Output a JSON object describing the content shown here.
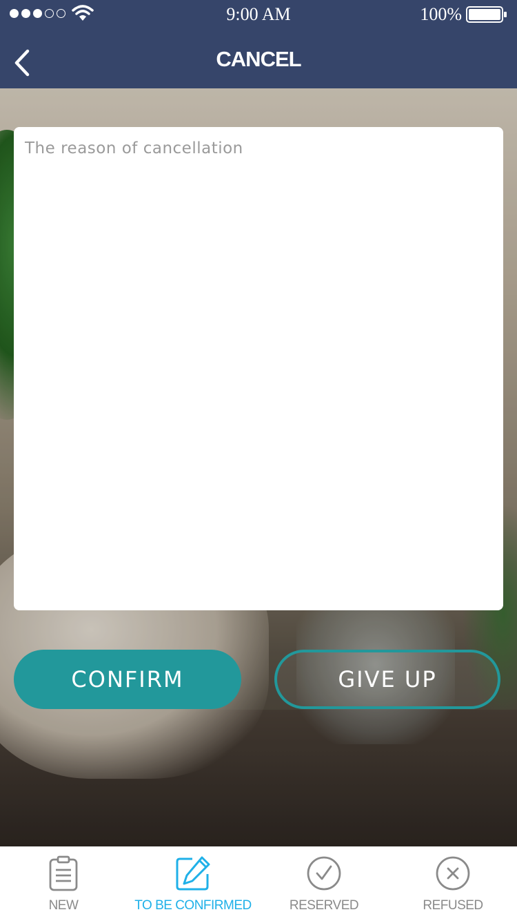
{
  "status_bar": {
    "time": "9:00 AM",
    "battery": "100%",
    "signal_dots_filled": 3,
    "signal_dots_total": 5,
    "icons": [
      "wifi-icon",
      "battery-icon"
    ]
  },
  "nav": {
    "title": "CANCEL",
    "back_icon": "chevron-left-icon"
  },
  "form": {
    "reason_placeholder": "The reason of cancellation",
    "reason_value": ""
  },
  "buttons": {
    "confirm_label": "CONFIRM",
    "give_up_label": "GIVE UP"
  },
  "tabs": [
    {
      "label": "NEW",
      "icon": "clipboard-icon",
      "active": false
    },
    {
      "label": "TO BE CONFIRMED",
      "icon": "edit-icon",
      "active": true
    },
    {
      "label": "RESERVED",
      "icon": "check-circle-icon",
      "active": false
    },
    {
      "label": "REFUSED",
      "icon": "x-circle-icon",
      "active": false
    }
  ],
  "colors": {
    "header": "#36456a",
    "accent": "#22989b",
    "tab_active": "#1fb0e8",
    "tab_inactive": "#8a8a8a"
  }
}
